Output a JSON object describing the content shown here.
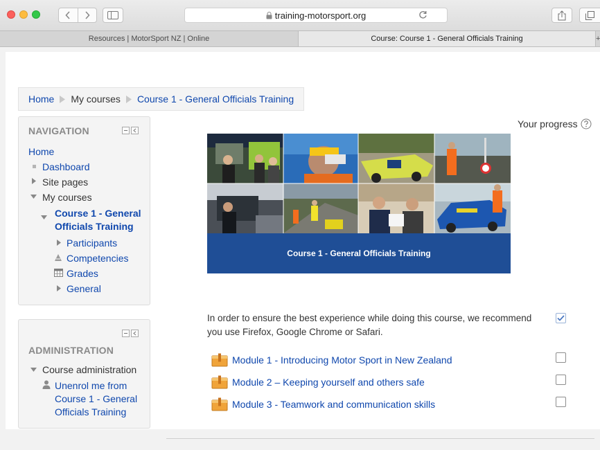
{
  "browser": {
    "url": "training-motorsport.org",
    "tabs": [
      {
        "label": "Resources | MotorSport NZ | Online"
      },
      {
        "label": "Course: Course 1 - General Officials Training"
      }
    ],
    "tab_overflow": "+"
  },
  "breadcrumb": [
    "Home",
    "My courses",
    "Course 1 - General Officials Training"
  ],
  "navigation": {
    "title": "NAVIGATION",
    "home": "Home",
    "dashboard": "Dashboard",
    "site_pages": "Site pages",
    "my_courses": "My courses",
    "course_line1": "Course 1 - General",
    "course_line2": "Officials Training",
    "participants": "Participants",
    "competencies": "Competencies",
    "grades": "Grades",
    "general": "General"
  },
  "administration": {
    "title": "ADMINISTRATION",
    "course_admin": "Course administration",
    "unenrol_line1": "Unenrol me from",
    "unenrol_line2": "Course 1 - General",
    "unenrol_line3": "Officials Training"
  },
  "progress_label": "Your progress",
  "banner_caption": "Course 1 - General Officials Training",
  "notice": "In order to ensure the best experience while doing this course, we recommend you use Firefox, Google Chrome or Safari.",
  "modules": [
    {
      "label": "Module 1 - Introducing Motor Sport in New Zealand",
      "done": false
    },
    {
      "label": "Module 2 – Keeping yourself and others safe",
      "done": false
    },
    {
      "label": "Module 3 - Teamwork and communication skills",
      "done": false
    }
  ],
  "notice_done": true,
  "colors": {
    "link": "#0f47ad",
    "banner_footer": "#1f4e96",
    "module_icon": "#f0a43a"
  }
}
